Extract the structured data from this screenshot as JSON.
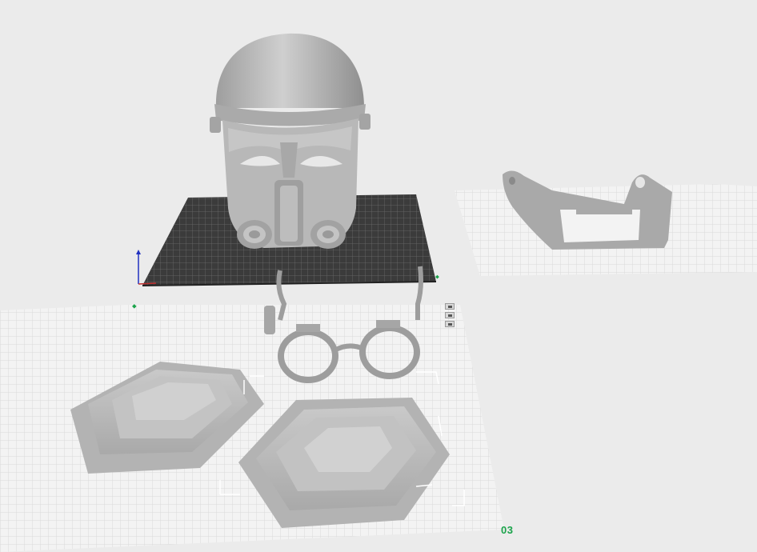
{
  "viewport": {
    "plate_label": "03"
  },
  "objects": [
    {
      "name": "helmet"
    },
    {
      "name": "face-frame"
    },
    {
      "name": "goggles"
    },
    {
      "name": "hex-shoulder-left"
    },
    {
      "name": "hex-shoulder-right"
    }
  ],
  "colors": {
    "background": "#ebebeb",
    "plate_grid": "#f4f4f4",
    "dark_plate": "#3a3a3a",
    "model": "#b9b9b9",
    "accent_green": "#1aa34a"
  }
}
